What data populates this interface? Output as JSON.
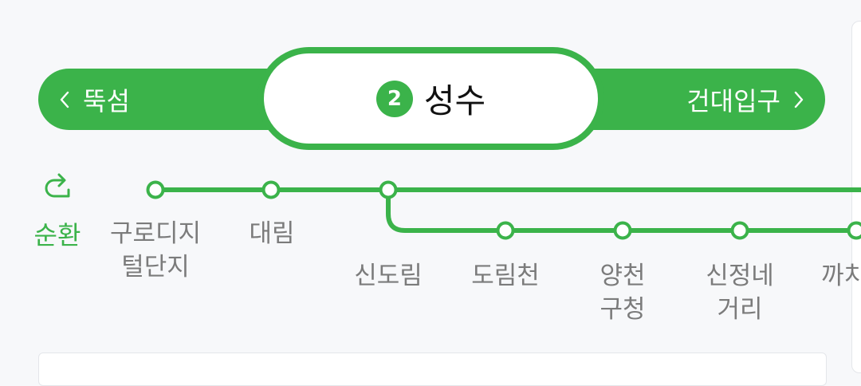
{
  "header": {
    "prev_station": "뚝섬",
    "next_station": "건대입구",
    "current_station": "성수",
    "line_number": "2",
    "accent": "#3bb34a"
  },
  "route": {
    "circular_label": "순환",
    "stations_top": [
      "구로디지\n털단지",
      "대림"
    ],
    "stations_branch": [
      "신도림",
      "도림천",
      "양천\n구청",
      "신정네\n거리",
      "까치"
    ]
  }
}
